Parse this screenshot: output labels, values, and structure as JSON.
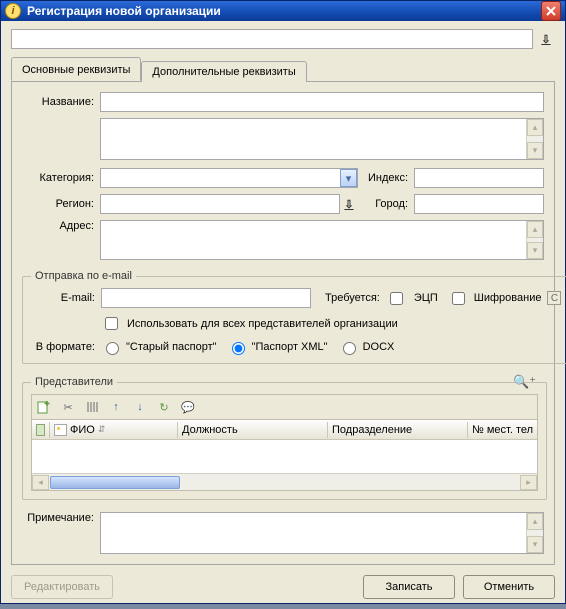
{
  "window": {
    "title": "Регистрация новой организации"
  },
  "tabs": {
    "main": "Основные реквизиты",
    "extra": "Дополнительные реквизиты"
  },
  "form": {
    "name_lbl": "Название:",
    "category_lbl": "Категория:",
    "index_lbl": "Индекс:",
    "region_lbl": "Регион:",
    "city_lbl": "Город:",
    "address_lbl": "Адрес:",
    "note_lbl": "Примечание:",
    "name": "",
    "category": "",
    "index": "",
    "region": "",
    "city": "",
    "address": "",
    "note": ""
  },
  "email": {
    "legend": "Отправка по e-mail",
    "email_lbl": "E-mail:",
    "required_lbl": "Требуется:",
    "ecp_lbl": "ЭЦП",
    "encrypt_lbl": "Шифрование",
    "use_reps_lbl": "Использовать для всех представителей организации",
    "format_lbl": "В формате:",
    "fmt_old": "\"Старый паспорт\"",
    "fmt_xml": "\"Паспорт XML\"",
    "fmt_docx": "DOCX",
    "email": ""
  },
  "reps": {
    "legend": "Представители",
    "cols": {
      "fio": "ФИО",
      "position": "Должность",
      "dept": "Подразделение",
      "phone": "№ мест. тел"
    }
  },
  "buttons": {
    "edit": "Редактировать",
    "save": "Записать",
    "cancel": "Отменить"
  }
}
